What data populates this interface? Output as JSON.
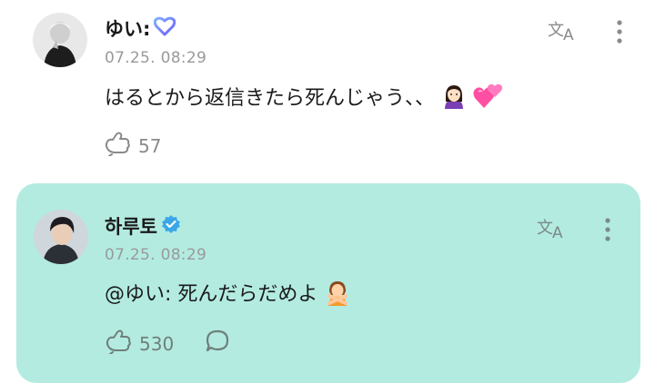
{
  "post": {
    "author_name": "ゆい:",
    "timestamp": "07.25. 08:29",
    "message": "はるとから返信きたら死んじゃう、、",
    "like_count": "57",
    "icons": [
      "heart-badge-icon",
      "translate-icon",
      "more-icon",
      "like-icon",
      "woman-emoji-icon",
      "hearts-emoji-icon"
    ]
  },
  "reply": {
    "author_name": "하루토",
    "timestamp": "07.25. 08:29",
    "message": "@ゆい: 死んだらだめよ",
    "like_count": "530",
    "icons": [
      "verified-badge-icon",
      "translate-icon",
      "more-icon",
      "like-icon",
      "comment-icon",
      "no-gesture-emoji-icon"
    ]
  },
  "colors": {
    "reply_background": "#b3ebe1",
    "verified_badge": "#3aa7e8",
    "timestamp": "#9a9a9a",
    "action": "#8a8a8a"
  }
}
